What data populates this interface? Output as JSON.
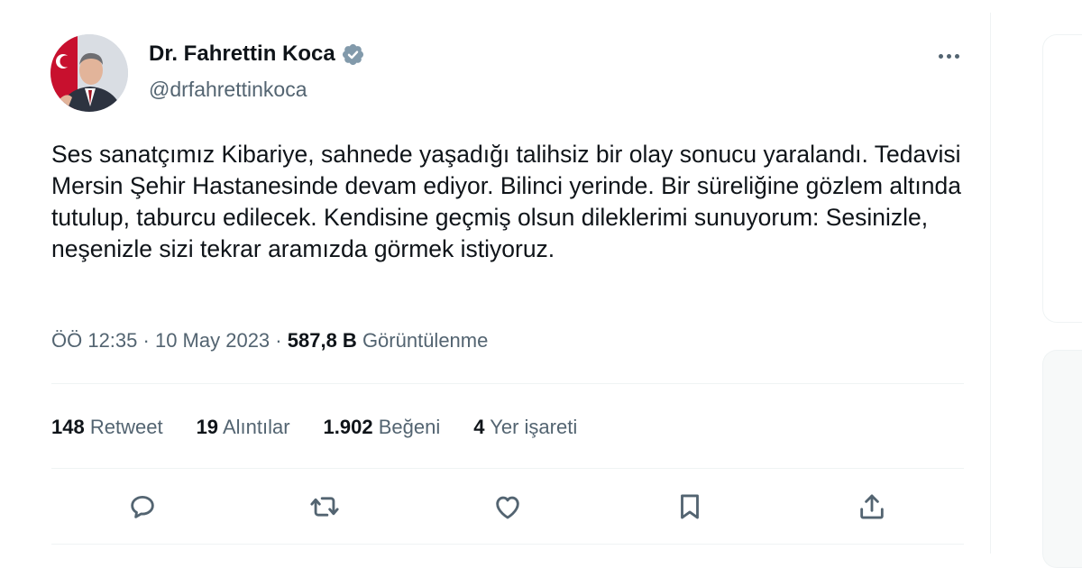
{
  "author": {
    "name": "Dr. Fahrettin Koca",
    "handle": "@drfahrettinkoca"
  },
  "tweet": {
    "text": "Ses sanatçımız Kibariye, sahnede yaşadığı talihsiz bir olay sonucu yaralandı. Tedavisi Mersin Şehir Hastanesinde devam ediyor. Bilinci yerinde. Bir süreliğine gözlem altında tutulup, taburcu edilecek. Kendisine geçmiş olsun dileklerimi sunuyorum: Sesinizle, neşenizle sizi tekrar aramızda görmek istiyoruz.",
    "time": "ÖÖ 12:35",
    "date": "10 May 2023",
    "sep": "·",
    "views_count": "587,8 B",
    "views_label": "Görüntülenme"
  },
  "stats": {
    "retweets": {
      "count": "148",
      "label": "Retweet"
    },
    "quotes": {
      "count": "19",
      "label": "Alıntılar"
    },
    "likes": {
      "count": "1.902",
      "label": "Beğeni"
    },
    "bookmarks": {
      "count": "4",
      "label": "Yer işareti"
    }
  },
  "actions": [
    "reply-icon",
    "retweet-icon",
    "like-icon",
    "bookmark-icon",
    "share-icon"
  ],
  "colors": {
    "text": "#0f1419",
    "secondary": "#536471",
    "verified": "#829aab",
    "divider": "#eff3f4"
  }
}
